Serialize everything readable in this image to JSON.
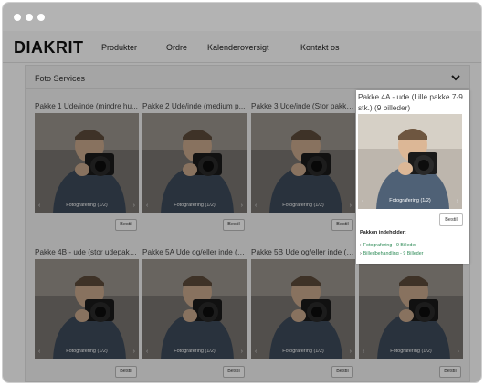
{
  "window": {
    "dots": [
      "close",
      "minimize",
      "maximize"
    ]
  },
  "nav": {
    "logo": "DIAKRIT",
    "items": [
      "Produkter",
      "Ordre",
      "Kalenderoversigt",
      "Kontakt os"
    ]
  },
  "section": {
    "title": "Foto Services",
    "toggle_icon": "chevron-down-icon"
  },
  "cards": [
    {
      "title": "Pakke 1 Ude/inde (mindre hu...",
      "caption": "Fotografering (1/2)",
      "button": "Bestil"
    },
    {
      "title": "Pakke 2 Ude/inde (medium p...",
      "caption": "Fotografering (1/2)",
      "button": "Bestil"
    },
    {
      "title": "Pakke 3 Ude/inde (Stor pakke...",
      "caption": "Fotografering (1/2)",
      "button": "Bestil"
    },
    {
      "title": "Pakke 4B - ude (stor udepakk...",
      "caption": "Fotografering (1/2)",
      "button": "Bestil"
    },
    {
      "title": "Pakke 5A Ude og/eller inde (V...",
      "caption": "Fotografering (1/2)",
      "button": "Bestil"
    },
    {
      "title": "Pakke 5B Ude og/eller inde (V...",
      "caption": "Fotografering (1/2)",
      "button": "Bestil"
    },
    {
      "title": "",
      "caption": "Fotografering (1/2)",
      "button": "Bestil"
    }
  ],
  "highlight": {
    "title": "Pakke 4A - ude (Lille pakke 7-9 stk.) (9 billeder)",
    "caption": "Fotografering (1/2)",
    "button": "Bestil",
    "contents_label": "Pakken indeholder:",
    "items": [
      "Fotografering - 9 Billeder",
      "Billedbehandling - 9 Billeder"
    ]
  },
  "colors": {
    "link_green": "#2e8b57",
    "overlay": "rgba(0,0,0,0.32)"
  }
}
